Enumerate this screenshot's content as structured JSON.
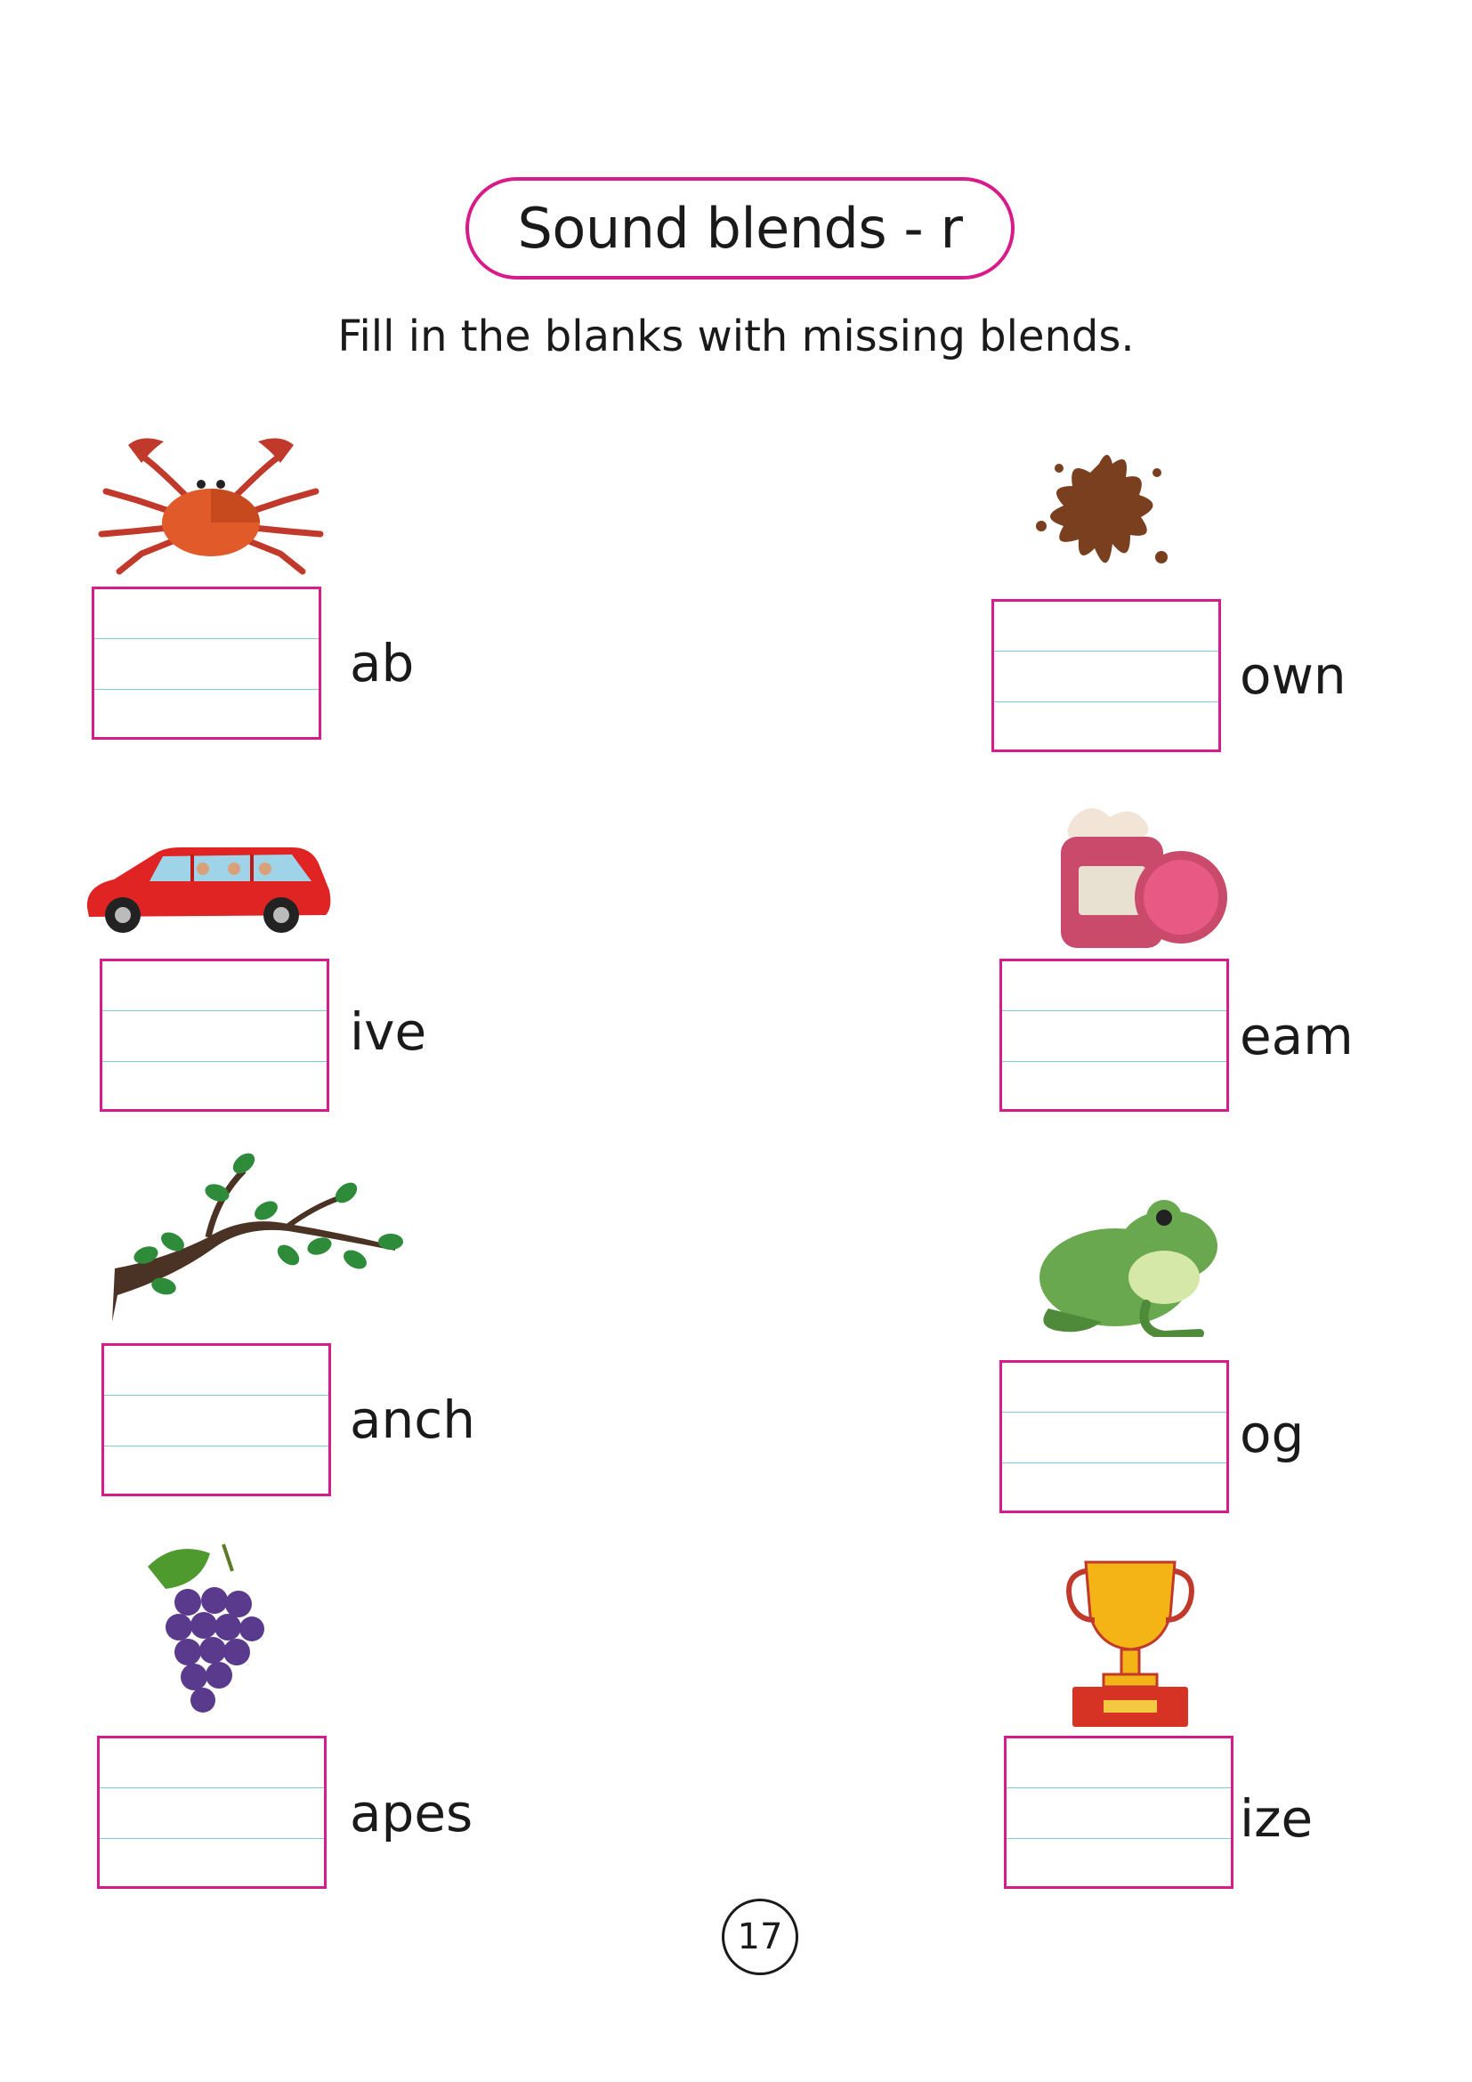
{
  "title": "Sound blends - r",
  "instruction": "Fill in the blanks with missing blends.",
  "page_number": "17",
  "items": [
    {
      "picture": "crab",
      "word": "ab"
    },
    {
      "picture": "car",
      "word": "ive"
    },
    {
      "picture": "branch",
      "word": "anch"
    },
    {
      "picture": "grapes",
      "word": "apes"
    },
    {
      "picture": "brown-splash",
      "word": "own"
    },
    {
      "picture": "cream-jar",
      "word": "eam"
    },
    {
      "picture": "frog",
      "word": "og"
    },
    {
      "picture": "trophy-prize",
      "word": "ize"
    }
  ],
  "colors": {
    "pill_border": "#d81b8a",
    "box_border": "#d81b8a",
    "guide_line": "#7fc9d6"
  }
}
